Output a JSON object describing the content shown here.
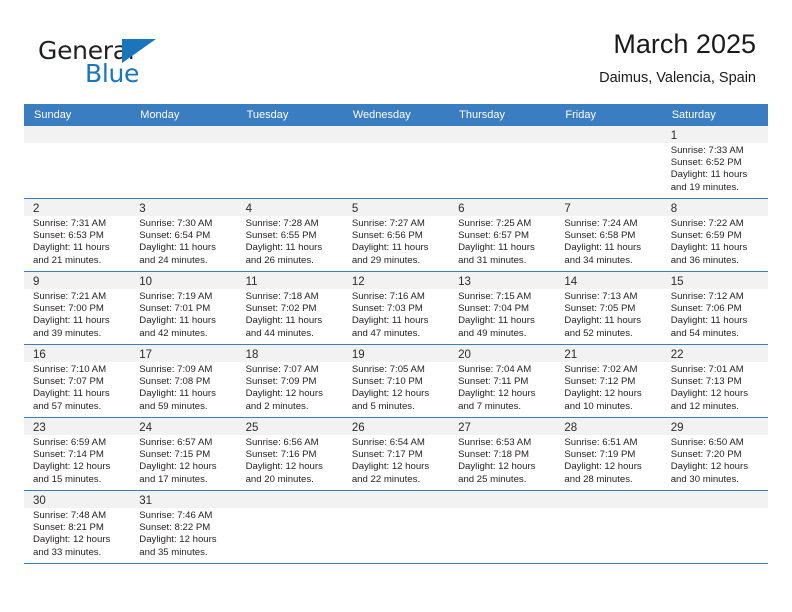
{
  "brand": {
    "name_top": "General",
    "name_bottom": "Blue",
    "accent_color": "#1b75bb"
  },
  "header": {
    "title": "March 2025",
    "subtitle": "Daimus, Valencia, Spain"
  },
  "theme": {
    "header_row_bg": "#3a7dc0",
    "day_band_bg": "#f2f2f2",
    "row_divider": "#3a7dc0",
    "text_color": "#231f20"
  },
  "weekdays": [
    "Sunday",
    "Monday",
    "Tuesday",
    "Wednesday",
    "Thursday",
    "Friday",
    "Saturday"
  ],
  "labels": {
    "sunrise_prefix": "Sunrise: ",
    "sunset_prefix": "Sunset: ",
    "daylight_prefix": "Daylight: "
  },
  "weeks": [
    [
      {
        "empty": true
      },
      {
        "empty": true
      },
      {
        "empty": true
      },
      {
        "empty": true
      },
      {
        "empty": true
      },
      {
        "empty": true
      },
      {
        "day": "1",
        "sunrise": "Sunrise: 7:33 AM",
        "sunset": "Sunset: 6:52 PM",
        "daylight": "Daylight: 11 hours and 19 minutes."
      }
    ],
    [
      {
        "day": "2",
        "sunrise": "Sunrise: 7:31 AM",
        "sunset": "Sunset: 6:53 PM",
        "daylight": "Daylight: 11 hours and 21 minutes."
      },
      {
        "day": "3",
        "sunrise": "Sunrise: 7:30 AM",
        "sunset": "Sunset: 6:54 PM",
        "daylight": "Daylight: 11 hours and 24 minutes."
      },
      {
        "day": "4",
        "sunrise": "Sunrise: 7:28 AM",
        "sunset": "Sunset: 6:55 PM",
        "daylight": "Daylight: 11 hours and 26 minutes."
      },
      {
        "day": "5",
        "sunrise": "Sunrise: 7:27 AM",
        "sunset": "Sunset: 6:56 PM",
        "daylight": "Daylight: 11 hours and 29 minutes."
      },
      {
        "day": "6",
        "sunrise": "Sunrise: 7:25 AM",
        "sunset": "Sunset: 6:57 PM",
        "daylight": "Daylight: 11 hours and 31 minutes."
      },
      {
        "day": "7",
        "sunrise": "Sunrise: 7:24 AM",
        "sunset": "Sunset: 6:58 PM",
        "daylight": "Daylight: 11 hours and 34 minutes."
      },
      {
        "day": "8",
        "sunrise": "Sunrise: 7:22 AM",
        "sunset": "Sunset: 6:59 PM",
        "daylight": "Daylight: 11 hours and 36 minutes."
      }
    ],
    [
      {
        "day": "9",
        "sunrise": "Sunrise: 7:21 AM",
        "sunset": "Sunset: 7:00 PM",
        "daylight": "Daylight: 11 hours and 39 minutes."
      },
      {
        "day": "10",
        "sunrise": "Sunrise: 7:19 AM",
        "sunset": "Sunset: 7:01 PM",
        "daylight": "Daylight: 11 hours and 42 minutes."
      },
      {
        "day": "11",
        "sunrise": "Sunrise: 7:18 AM",
        "sunset": "Sunset: 7:02 PM",
        "daylight": "Daylight: 11 hours and 44 minutes."
      },
      {
        "day": "12",
        "sunrise": "Sunrise: 7:16 AM",
        "sunset": "Sunset: 7:03 PM",
        "daylight": "Daylight: 11 hours and 47 minutes."
      },
      {
        "day": "13",
        "sunrise": "Sunrise: 7:15 AM",
        "sunset": "Sunset: 7:04 PM",
        "daylight": "Daylight: 11 hours and 49 minutes."
      },
      {
        "day": "14",
        "sunrise": "Sunrise: 7:13 AM",
        "sunset": "Sunset: 7:05 PM",
        "daylight": "Daylight: 11 hours and 52 minutes."
      },
      {
        "day": "15",
        "sunrise": "Sunrise: 7:12 AM",
        "sunset": "Sunset: 7:06 PM",
        "daylight": "Daylight: 11 hours and 54 minutes."
      }
    ],
    [
      {
        "day": "16",
        "sunrise": "Sunrise: 7:10 AM",
        "sunset": "Sunset: 7:07 PM",
        "daylight": "Daylight: 11 hours and 57 minutes."
      },
      {
        "day": "17",
        "sunrise": "Sunrise: 7:09 AM",
        "sunset": "Sunset: 7:08 PM",
        "daylight": "Daylight: 11 hours and 59 minutes."
      },
      {
        "day": "18",
        "sunrise": "Sunrise: 7:07 AM",
        "sunset": "Sunset: 7:09 PM",
        "daylight": "Daylight: 12 hours and 2 minutes."
      },
      {
        "day": "19",
        "sunrise": "Sunrise: 7:05 AM",
        "sunset": "Sunset: 7:10 PM",
        "daylight": "Daylight: 12 hours and 5 minutes."
      },
      {
        "day": "20",
        "sunrise": "Sunrise: 7:04 AM",
        "sunset": "Sunset: 7:11 PM",
        "daylight": "Daylight: 12 hours and 7 minutes."
      },
      {
        "day": "21",
        "sunrise": "Sunrise: 7:02 AM",
        "sunset": "Sunset: 7:12 PM",
        "daylight": "Daylight: 12 hours and 10 minutes."
      },
      {
        "day": "22",
        "sunrise": "Sunrise: 7:01 AM",
        "sunset": "Sunset: 7:13 PM",
        "daylight": "Daylight: 12 hours and 12 minutes."
      }
    ],
    [
      {
        "day": "23",
        "sunrise": "Sunrise: 6:59 AM",
        "sunset": "Sunset: 7:14 PM",
        "daylight": "Daylight: 12 hours and 15 minutes."
      },
      {
        "day": "24",
        "sunrise": "Sunrise: 6:57 AM",
        "sunset": "Sunset: 7:15 PM",
        "daylight": "Daylight: 12 hours and 17 minutes."
      },
      {
        "day": "25",
        "sunrise": "Sunrise: 6:56 AM",
        "sunset": "Sunset: 7:16 PM",
        "daylight": "Daylight: 12 hours and 20 minutes."
      },
      {
        "day": "26",
        "sunrise": "Sunrise: 6:54 AM",
        "sunset": "Sunset: 7:17 PM",
        "daylight": "Daylight: 12 hours and 22 minutes."
      },
      {
        "day": "27",
        "sunrise": "Sunrise: 6:53 AM",
        "sunset": "Sunset: 7:18 PM",
        "daylight": "Daylight: 12 hours and 25 minutes."
      },
      {
        "day": "28",
        "sunrise": "Sunrise: 6:51 AM",
        "sunset": "Sunset: 7:19 PM",
        "daylight": "Daylight: 12 hours and 28 minutes."
      },
      {
        "day": "29",
        "sunrise": "Sunrise: 6:50 AM",
        "sunset": "Sunset: 7:20 PM",
        "daylight": "Daylight: 12 hours and 30 minutes."
      }
    ],
    [
      {
        "day": "30",
        "sunrise": "Sunrise: 7:48 AM",
        "sunset": "Sunset: 8:21 PM",
        "daylight": "Daylight: 12 hours and 33 minutes."
      },
      {
        "day": "31",
        "sunrise": "Sunrise: 7:46 AM",
        "sunset": "Sunset: 8:22 PM",
        "daylight": "Daylight: 12 hours and 35 minutes."
      },
      {
        "empty": true
      },
      {
        "empty": true
      },
      {
        "empty": true
      },
      {
        "empty": true
      },
      {
        "empty": true
      }
    ]
  ]
}
